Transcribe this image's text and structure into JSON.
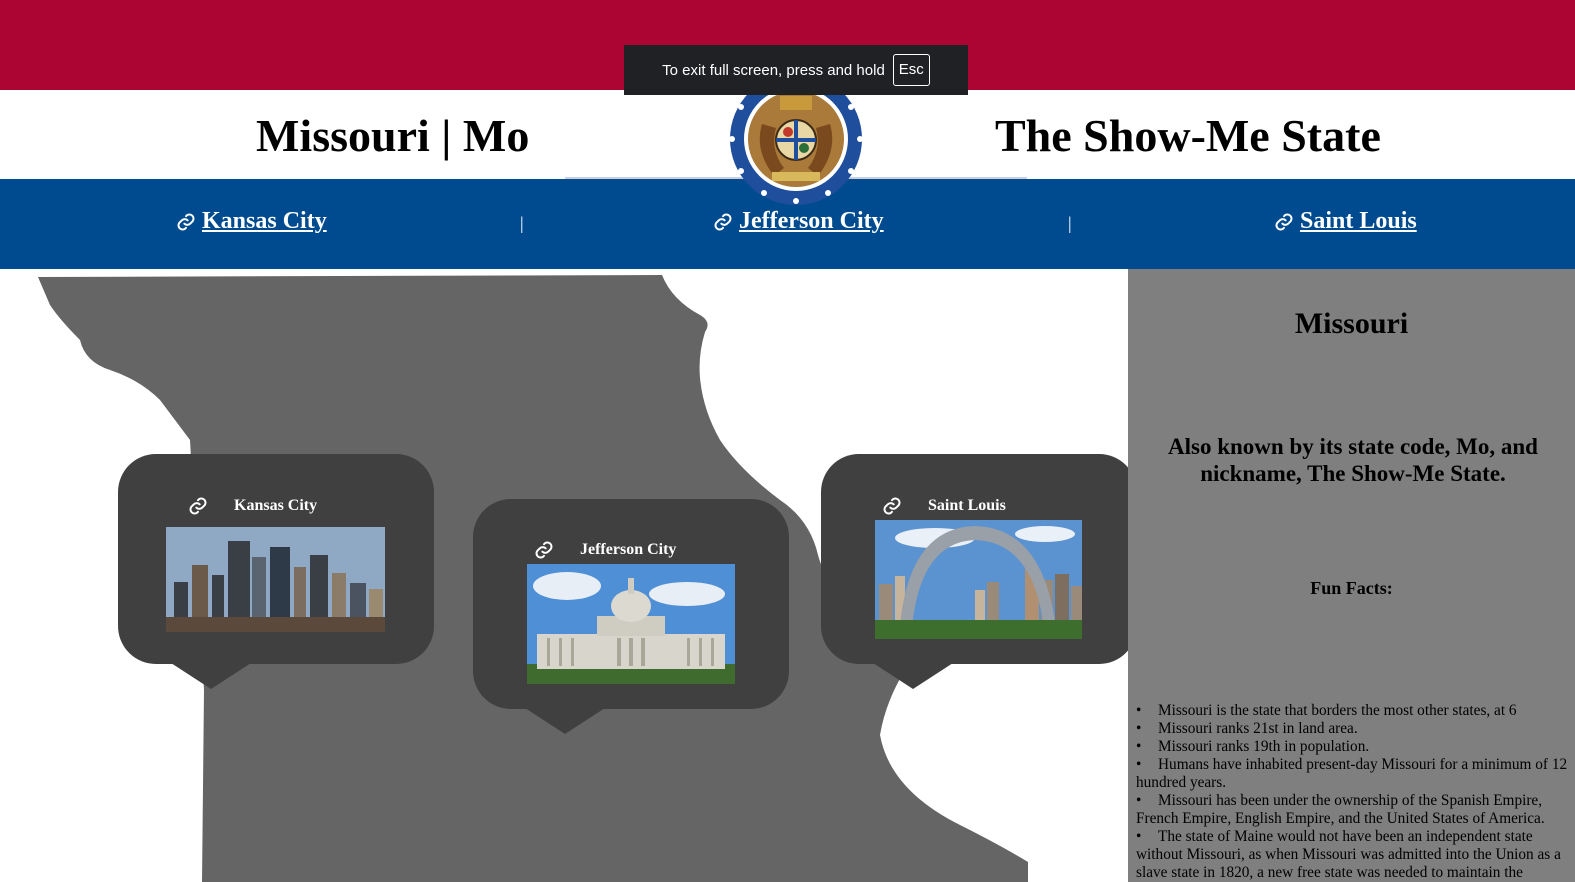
{
  "header": {
    "title_left": "Missouri | Mo",
    "title_right": "The Show-Me State"
  },
  "seal": {
    "label": "Missouri state seal",
    "ring_text": "MDCCCXX"
  },
  "nav": {
    "links": [
      {
        "label": "Kansas City"
      },
      {
        "label": "Jefferson City"
      },
      {
        "label": "Saint Louis"
      }
    ],
    "separator": "|"
  },
  "map": {
    "popups": [
      {
        "label": "Kansas City",
        "image": "Kansas City skyline"
      },
      {
        "label": "Jefferson City",
        "image": "Missouri State Capitol"
      },
      {
        "label": "Saint Louis",
        "image": "Gateway Arch and downtown Saint Louis"
      }
    ]
  },
  "sidebar": {
    "title": "Missouri",
    "subtitle": "Also known by its state code, Mo, and nickname, The Show-Me State.",
    "facts_heading": "Fun Facts:",
    "facts": [
      "Missouri is the state that borders the most other states, at 6",
      "Missouri ranks 21st in land area.",
      "Missouri ranks 19th in population.",
      "Humans have inhabited present-day Missouri for a minimum of 12 hundred years.",
      "Missouri has been under the ownership of the Spanish Empire, French Empire, English Empire, and the United States of America.",
      "The state of Maine would not have been an independent state without Missouri, as when Missouri was admitted into the Union as a slave state in 1820, a new free state was needed to maintain the"
    ]
  },
  "fullscreen_notice": {
    "text": "To exit full screen, press and hold",
    "key": "Esc"
  },
  "colors": {
    "flag_red": "#ad0533",
    "flag_white": "#ffffff",
    "flag_blue": "#004b8f",
    "map_gray": "#656565",
    "popup_bg": "#404040",
    "sidebar_bg": "#7f7f7f"
  }
}
